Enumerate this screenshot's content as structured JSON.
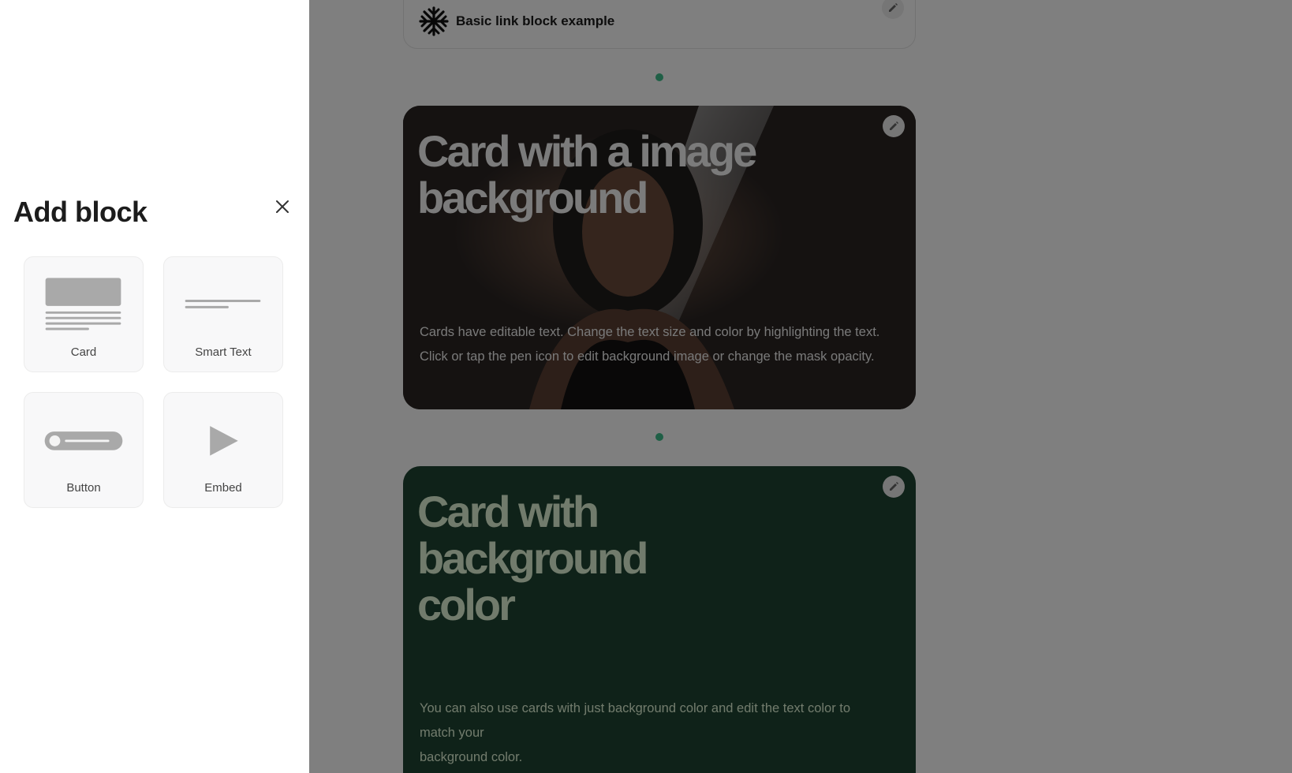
{
  "canvas": {
    "link_block": {
      "title": "Basic link block example",
      "logo_icon": "asterisk-logo-icon",
      "edit_icon": "pen-icon"
    },
    "image_card": {
      "heading": "Card with a image background",
      "body_lines": [
        "Cards have editable text. Change the text size and color by highlighting the text.",
        "Click or tap the pen icon to edit background image or change the mask opacity."
      ],
      "edit_icon": "pen-icon"
    },
    "color_card": {
      "heading": "Card with background color",
      "body_lines": [
        "You can also use cards with just background color and edit the text color to",
        "match your",
        "background color."
      ],
      "background_color": "#1f4433",
      "text_color": "#e3f7d9",
      "edit_icon": "pen-icon"
    },
    "separator_color": "#3fbf8c"
  },
  "panel": {
    "title": "Add block",
    "close_icon": "close-icon",
    "tiles": [
      {
        "label": "Card",
        "icon": "card-block-icon"
      },
      {
        "label": "Smart Text",
        "icon": "smart-text-block-icon"
      },
      {
        "label": "Button",
        "icon": "button-block-icon"
      },
      {
        "label": "Embed",
        "icon": "play-embed-icon"
      }
    ]
  }
}
